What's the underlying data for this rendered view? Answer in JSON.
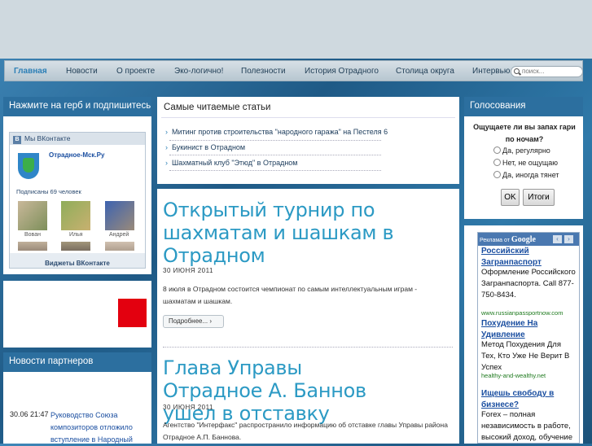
{
  "nav": {
    "items": [
      "Главная",
      "Новости",
      "О проекте",
      "Эко-логично!",
      "Полезности",
      "История Отрадного",
      "Столица округа",
      "Интервью"
    ],
    "search_placeholder": "поиск..."
  },
  "left": {
    "subscribe_title": "Нажмите на герб и подпишитесь",
    "vk": {
      "header": "Мы ВКонтакте",
      "group_name": "Отрадное-Мск.Ру",
      "subscribers": "Подписаны 69 человек",
      "members": [
        "Вован",
        "Илья",
        "Андрей"
      ],
      "footer": "Виджеты ВКонтакте"
    },
    "partners_title": "Новости партнеров",
    "partner_news": {
      "time": "30.06 21:47",
      "text": "Руководство Союза композиторов отложило вступление в Народный"
    }
  },
  "center": {
    "popular_title": "Самые читаемые статьи",
    "popular": [
      "Митинг против строительства \"народного гаража\" на Пестеля 6",
      "Букинист в Отрадном",
      "Шахматный клуб \"Этюд\" в Отрадном"
    ],
    "articles": [
      {
        "title": "Открытый турнир по шахматам и шашкам в Отрадном",
        "date": "30 ИЮНЯ 2011",
        "excerpt": "8 июля в Отрадном состоится чемпионат по самым интеллектуальным играм - шахматам и шашкам.",
        "more": "Подробнее..."
      },
      {
        "title": "Глава Управы Отрадное А. Баннов ушел в отставку",
        "date": "30 ИЮНЯ 2011",
        "excerpt": "Агентство \"Интерфакс\" распространило информацию об отставке главы Управы района Отрадное А.П. Баннова."
      }
    ]
  },
  "right": {
    "poll_title": "Голосования",
    "question": "Ощущаете ли вы запах гари по ночам?",
    "options": [
      "Да, регулярно",
      "Нет, не ощущаю",
      "Да, иногда тянет"
    ],
    "ok_label": "OK",
    "results_label": "Итоги",
    "ads_header": "Реклама от",
    "google": "Google",
    "ads": [
      {
        "title": "Российский Загранпаспорт",
        "text": "Оформление Российского Загранпаспорта. Call 877-750-8434.",
        "url": "www.russianpassportnow.com"
      },
      {
        "title": "Похудение На Удивление",
        "text": "Метод Похудения Для Тех, Кто Уже Не Верит В Успех",
        "url": "healthy-and-wealthy.net"
      },
      {
        "title": "Ищешь свободу в бизнесе?",
        "text": "Forex – полная независимость в работе, высокий доход, обучение"
      }
    ]
  },
  "colors": {
    "panel_title_bg": "#2c6f9f",
    "article_title": "#2c9ac4",
    "red_block": "#e3000f"
  }
}
